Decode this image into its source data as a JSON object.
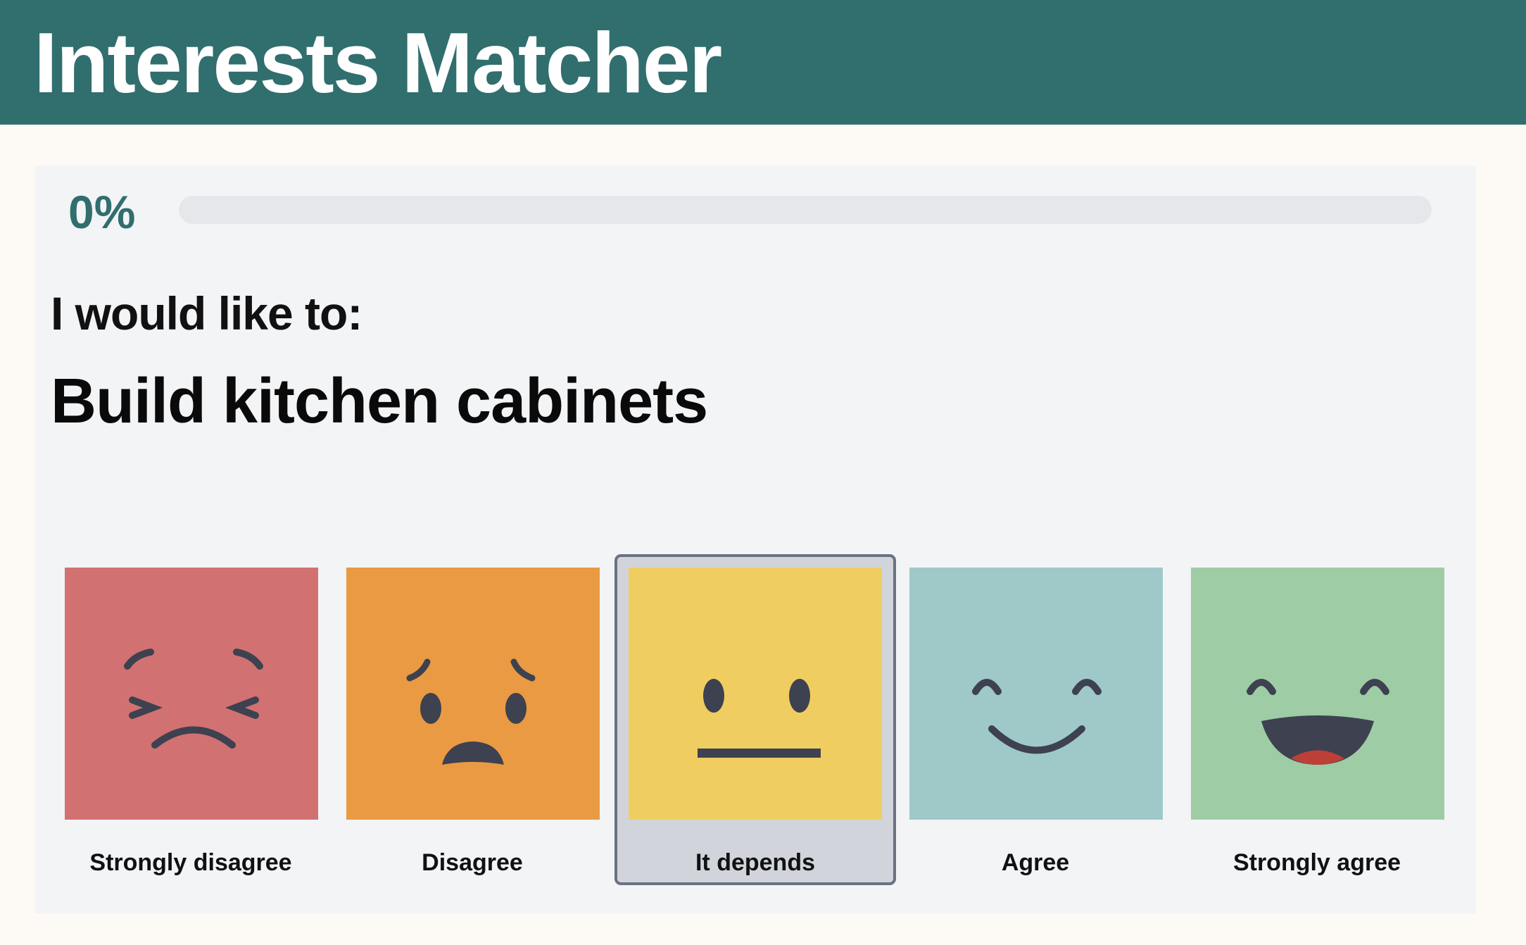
{
  "header": {
    "title": "Interests Matcher"
  },
  "progress": {
    "label": "0%",
    "fraction": 0
  },
  "question": {
    "prompt": "I would like to:",
    "text": "Build kitchen cabinets"
  },
  "options": [
    {
      "label": "Strongly disagree",
      "color": "#d27172",
      "icon": "tired-face-icon",
      "selected": false
    },
    {
      "label": "Disagree",
      "color": "#e99a42",
      "icon": "worried-face-icon",
      "selected": false
    },
    {
      "label": "It depends",
      "color": "#f0cd61",
      "icon": "neutral-face-icon",
      "selected": true
    },
    {
      "label": "Agree",
      "color": "#9fc8c9",
      "icon": "smiling-face-icon",
      "selected": false
    },
    {
      "label": "Strongly agree",
      "color": "#9ecca5",
      "icon": "laughing-face-icon",
      "selected": false
    }
  ],
  "colors": {
    "header_bg": "#316e6e",
    "accent": "#316e6e",
    "face_features": "#3d4150",
    "tongue": "#bd3f37"
  }
}
